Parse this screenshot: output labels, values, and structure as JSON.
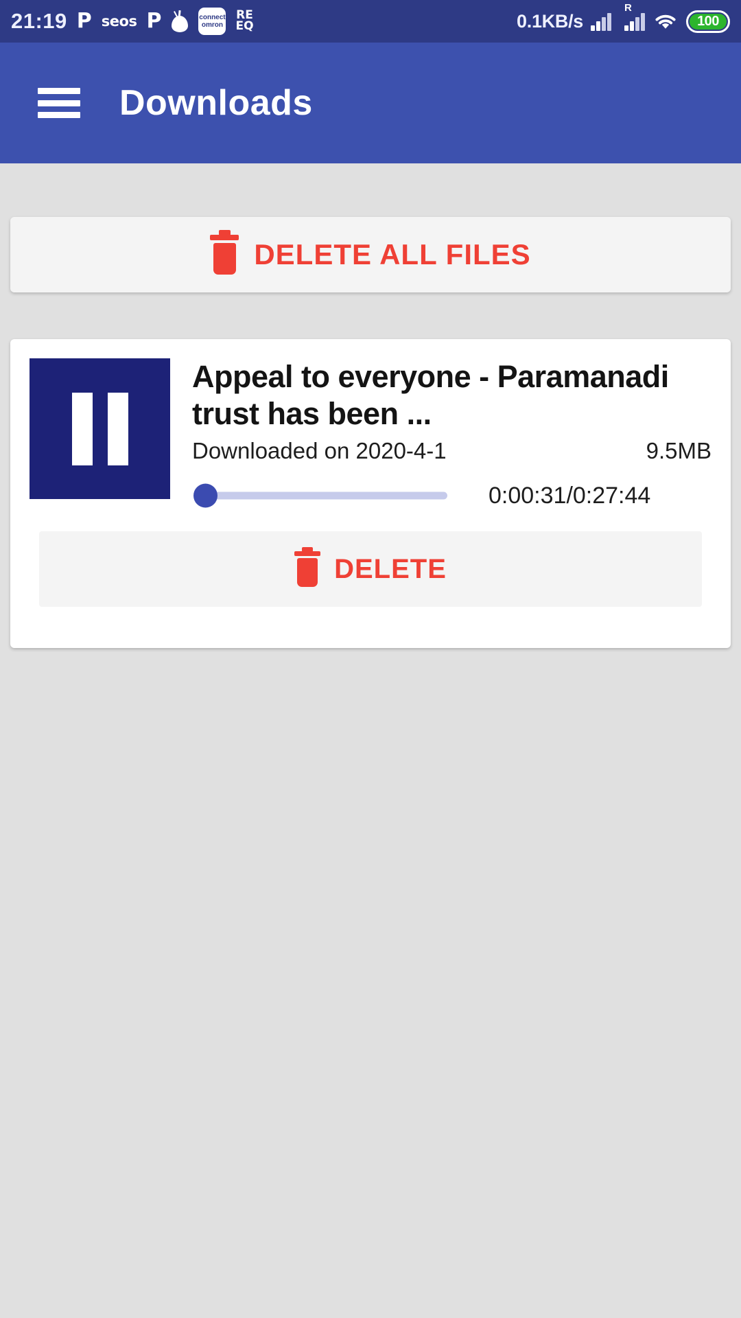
{
  "status_bar": {
    "time": "21:19",
    "notification_icons": [
      {
        "name": "p-app-icon",
        "glyph": "P"
      },
      {
        "name": "seos-icon",
        "glyph": "seos"
      },
      {
        "name": "p-app-icon-2",
        "glyph": "P"
      },
      {
        "name": "onion-icon",
        "glyph": ""
      },
      {
        "name": "omron-connect-icon",
        "line1": "connect",
        "line2": "omron"
      },
      {
        "name": "reeq-icon",
        "line1": "RE",
        "line2": "EQ"
      }
    ],
    "network_speed": "0.1KB/s",
    "roaming_label": "R",
    "battery_percent": "100",
    "bg_color": "#2e3a85"
  },
  "app_bar": {
    "title": "Downloads",
    "menu_icon": "hamburger-menu-icon",
    "bg_color": "#3d51ae"
  },
  "delete_all": {
    "label": "DELETE ALL FILES",
    "icon": "trash-icon",
    "color": "#ef4035"
  },
  "downloads": [
    {
      "thumbnail_icon": "pause-icon",
      "thumbnail_color": "#1d2277",
      "title": "Appeal to everyone - Paramanadi trust has been ...",
      "downloaded_on": "Downloaded on 2020-4-1",
      "size": "9.5MB",
      "time": "0:00:31/0:27:44",
      "progress_percent": 2,
      "delete_label": "DELETE",
      "delete_icon": "trash-icon"
    }
  ],
  "theme": {
    "page_background": "#e0e0e0",
    "card_background": "#ffffff",
    "button_background": "#f4f4f4",
    "danger": "#ef4035",
    "accent": "#3b4bb0"
  }
}
